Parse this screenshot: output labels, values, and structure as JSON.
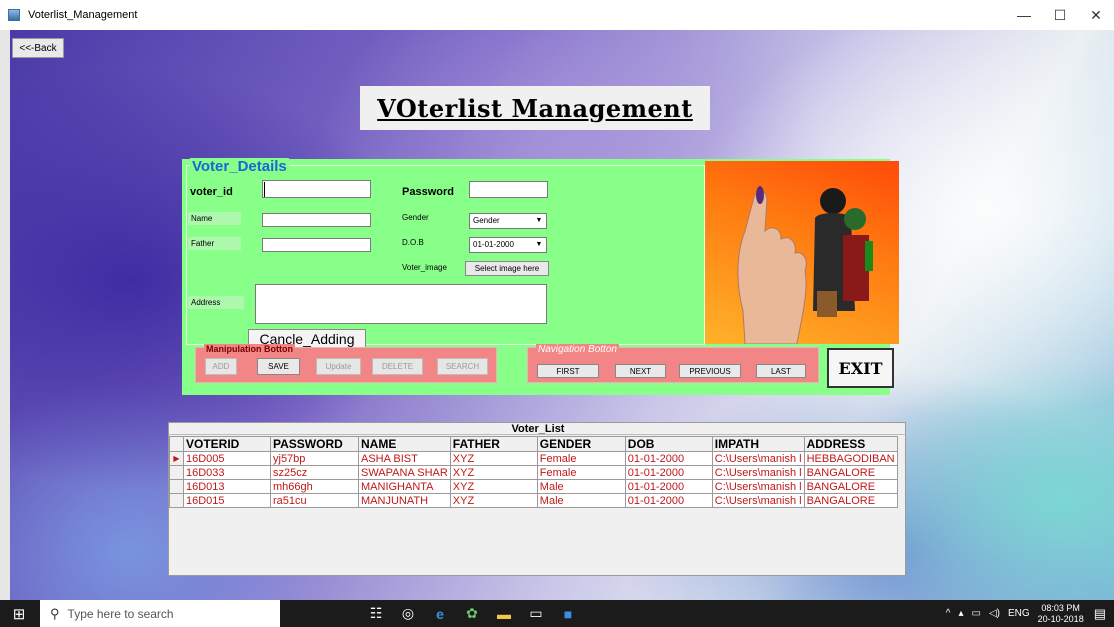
{
  "window": {
    "title": "Voterlist_Management",
    "minimize": "—",
    "maximize": "☐",
    "close": "✕"
  },
  "back_button": "<<-Back",
  "heading": "VOterlist Management",
  "voter_details": {
    "title": "Voter_Details",
    "voter_id_label": "voter_id",
    "password_label": "Password",
    "name_label": "Name",
    "gender_label": "Gender",
    "gender_value": "Gender",
    "father_label": "Father",
    "dob_label": "D.O.B",
    "dob_value": "01-01-2000",
    "voter_image_label": "Voter_image",
    "select_image_button": "Select image here",
    "address_label": "Address",
    "cancel_adding_button": "Cancle_Adding"
  },
  "manipulation": {
    "title": "Manipulation Botton",
    "buttons": [
      "ADD",
      "SAVE",
      "Update",
      "DELETE",
      "SEARCH"
    ]
  },
  "navigation": {
    "title": "Navigation Botton",
    "buttons": [
      "FIRST",
      "NEXT",
      "PREVIOUS",
      "LAST"
    ]
  },
  "exit_button": "EXIT",
  "grid": {
    "caption": "Voter_List",
    "columns": [
      "VOTERID",
      "PASSWORD",
      "NAME",
      "FATHER",
      "GENDER",
      "DOB",
      "IMPATH",
      "ADDRESS"
    ],
    "rows": [
      [
        "16D005",
        "yj57bp",
        "ASHA BIST",
        "XYZ",
        "Female",
        "01-01-2000",
        "C:\\Users\\manish l",
        "HEBBAGODIBAN"
      ],
      [
        "16D033",
        "sz25cz",
        "SWAPANA SHAR",
        "XYZ",
        "Female",
        "01-01-2000",
        "C:\\Users\\manish l",
        "BANGALORE"
      ],
      [
        "16D013",
        "mh66gh",
        "MANIGHANTA",
        "XYZ",
        "Male",
        "01-01-2000",
        "C:\\Users\\manish l",
        "BANGALORE"
      ],
      [
        "16D015",
        "ra51cu",
        "MANJUNATH",
        "XYZ",
        "Male",
        "01-01-2000",
        "C:\\Users\\manish l",
        "BANGALORE"
      ]
    ]
  },
  "taskbar": {
    "search_placeholder": "Type here to search",
    "language": "ENG",
    "time": "08:03 PM",
    "date": "20-10-2018"
  }
}
